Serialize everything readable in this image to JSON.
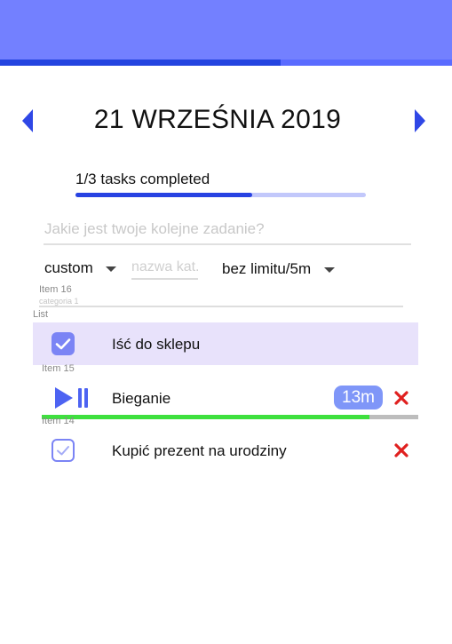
{
  "header": {
    "progress": 0.62
  },
  "date_nav": {
    "title": "21 WRZEŚNIA 2019"
  },
  "progress": {
    "text": "1/3 tasks completed",
    "fraction": 0.61
  },
  "new_task": {
    "placeholder": "Jakie jest twoje kolejne zadanie?",
    "value": ""
  },
  "filters": {
    "category_select": "custom",
    "category_input_placeholder": "nazwa kat.",
    "limit_select": "bez limitu/5m"
  },
  "list": {
    "item_16_label": "Item 16",
    "category_label": "categoria 1",
    "list_label": "List",
    "tasks": [
      {
        "label": "Iść do sklepu",
        "done": true
      },
      {
        "item_label": "Item 15",
        "label": "Bieganie",
        "time": "13m",
        "timer_progress": 0.87
      },
      {
        "item_label": "Item 14",
        "label": "Kupić prezent na urodziny",
        "done": false
      }
    ]
  },
  "colors": {
    "accent": "#4d63f2",
    "header": "#7380ff",
    "delete": "#e0201f",
    "timer": "#3ee03e"
  }
}
